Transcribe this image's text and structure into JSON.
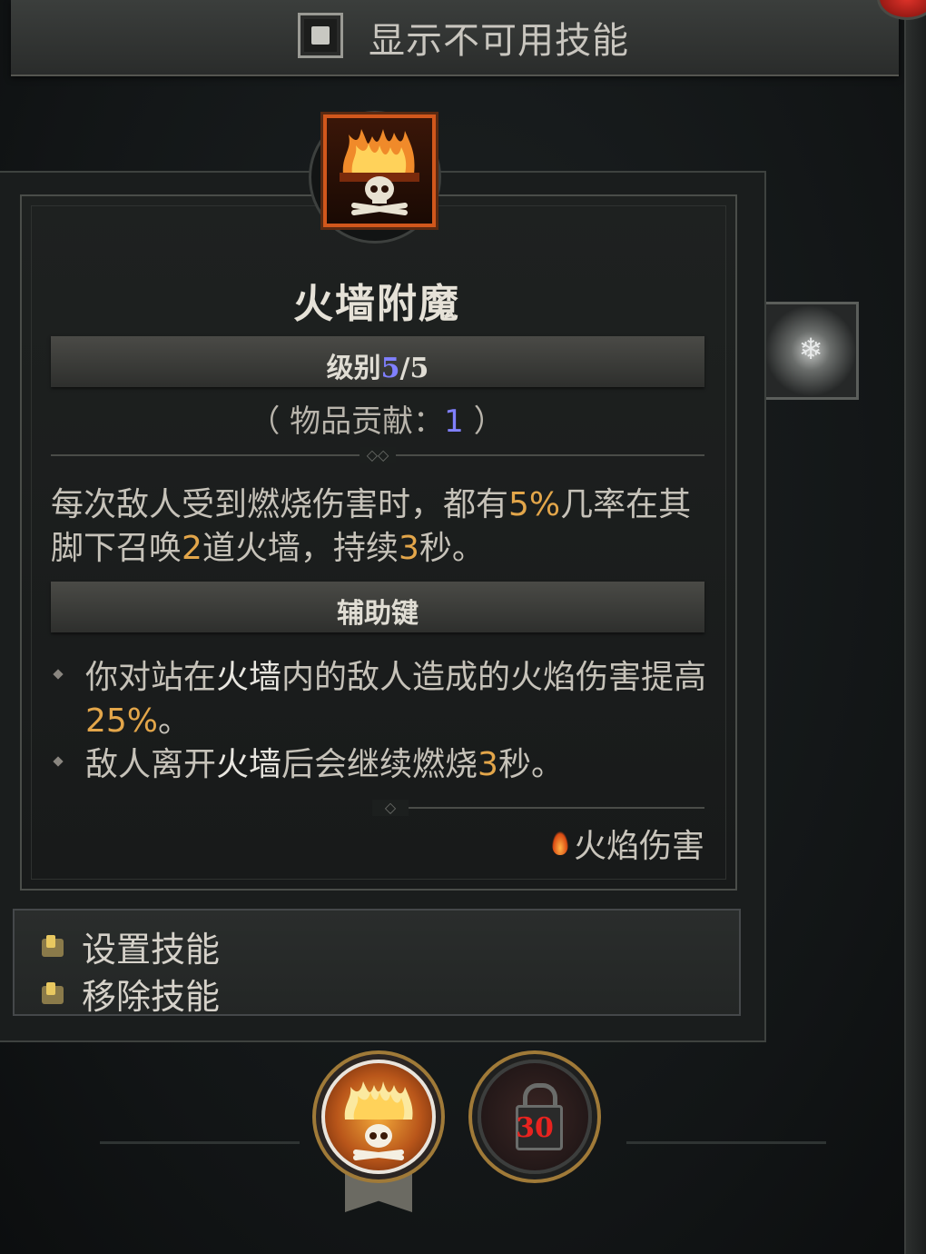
{
  "top_bar": {
    "toggle_label": "显示不可用技能",
    "toggle_checked": false
  },
  "skill": {
    "icon": "fire-wall-skull-icon",
    "title": "火墙附魔",
    "level_label": "级别",
    "level_current": "5",
    "level_separator": "/",
    "level_max": "5",
    "contribution_prefix": "（ 物品贡献：",
    "contribution_value": "1",
    "contribution_suffix": " ）",
    "description": {
      "p1": "每次敌人受到燃烧伤害时，都有",
      "v1": "5%",
      "p2": "几率在其脚下召唤",
      "v2": "2",
      "p3": "道火墙，持续",
      "v3": "3",
      "p4": "秒。"
    },
    "modifiers_header": "辅助键",
    "modifiers": [
      {
        "p1": "你对站在",
        "hl": "火墙",
        "p2": "内的敌人造成的火焰伤害提高",
        "v": "25%",
        "p3": "。"
      },
      {
        "p1": "敌人离开",
        "hl": "火墙",
        "p2": "后会继续燃烧",
        "v": "3",
        "p3": "秒。"
      }
    ],
    "damage_tag": "火焰伤害",
    "damage_tag_icon": "flame-icon"
  },
  "actions": [
    {
      "label": "设置技能",
      "icon": "key-icon"
    },
    {
      "label": "移除技能",
      "icon": "key-icon"
    }
  ],
  "side_skill": {
    "icon": "frost-swirl-icon"
  },
  "bottom": {
    "active_icon": "fire-wall-skull-icon",
    "locked_icon": "lock-icon",
    "locked_level": "30"
  },
  "colors": {
    "level_accent": "#8080ff",
    "value_accent": "#e3a64a",
    "locked_number": "#e8231f",
    "skill_border": "#d1571c"
  }
}
